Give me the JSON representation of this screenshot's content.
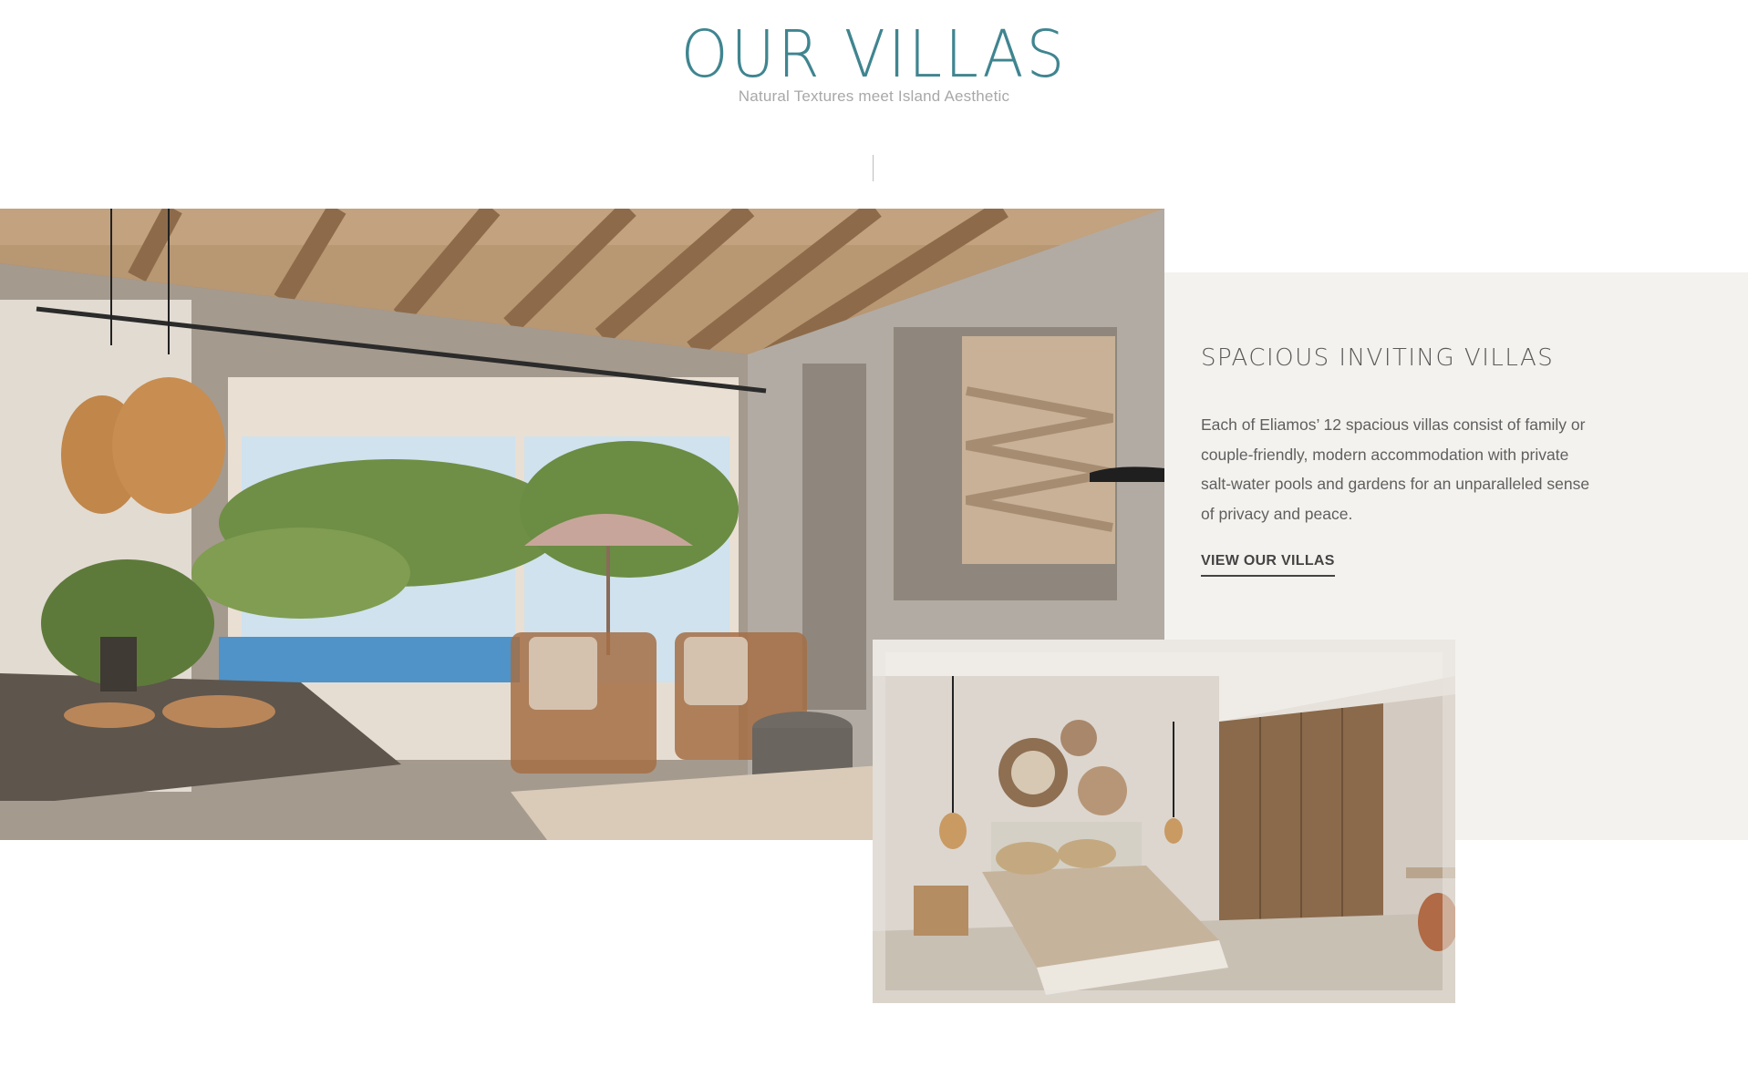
{
  "header": {
    "title": "OUR VILLAS",
    "subtitle": "Natural Textures meet Island Aesthetic"
  },
  "feature": {
    "heading": "SPACIOUS INVITING VILLAS",
    "body": "Each of Eliamos’ 12 spacious villas consist of family or couple-friendly, modern accommodation with private salt-water pools and gardens for an unparalleled sense of privacy and peace.",
    "cta_label": "VIEW OUR VILLAS"
  },
  "colors": {
    "title_teal": "#3f8590",
    "panel_beige": "#f4f2ee",
    "text_gray": "#5f5f5f"
  }
}
